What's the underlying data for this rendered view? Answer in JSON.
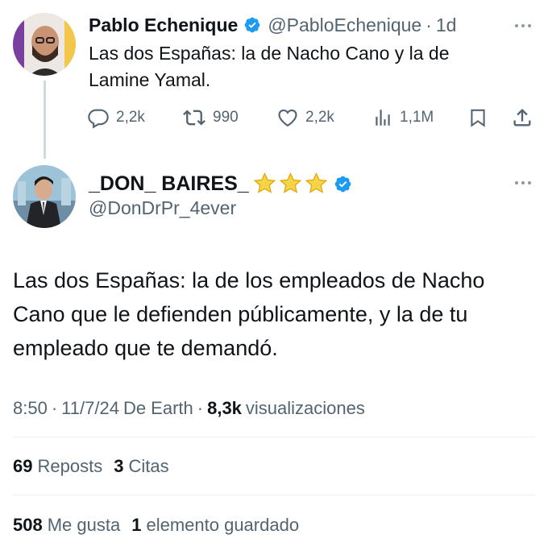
{
  "colors": {
    "accent": "#1d9bf0",
    "text": "#0f1419",
    "muted": "#536471",
    "divider": "#eff3f4"
  },
  "reply_to": {
    "name": "Pablo Echenique",
    "handle": "@PabloEchenique",
    "sep": "·",
    "time": "1d",
    "text_line1": "Las dos Españas: la de Nacho Cano y la de",
    "text_line2": "Lamine Yamal.",
    "actions": {
      "reply_count": "2,2k",
      "repost_count": "990",
      "like_count": "2,2k",
      "views_count": "1,1M"
    }
  },
  "tweet": {
    "name": "_DON_ BAIRES_",
    "name_emoji": "⭐⭐⭐",
    "handle": "@DonDrPr_4ever",
    "text_line1": "Las dos Españas: la de los empleados de Nacho",
    "text_line2": "Cano que le defienden públicamente, y la de tu",
    "text_line3": "empleado que te demandó.",
    "meta": {
      "time": "8:50",
      "sep1": "·",
      "date": "11/7/24",
      "source": "De Earth",
      "sep2": "·",
      "views_count": "8,3k",
      "views_label": "visualizaciones"
    },
    "stats": {
      "reposts_count": "69",
      "reposts_label": "Reposts",
      "quotes_count": "3",
      "quotes_label": "Citas",
      "likes_count": "508",
      "likes_label": "Me gusta",
      "bookmarks_count": "1",
      "bookmarks_label": "elemento guardado"
    }
  }
}
